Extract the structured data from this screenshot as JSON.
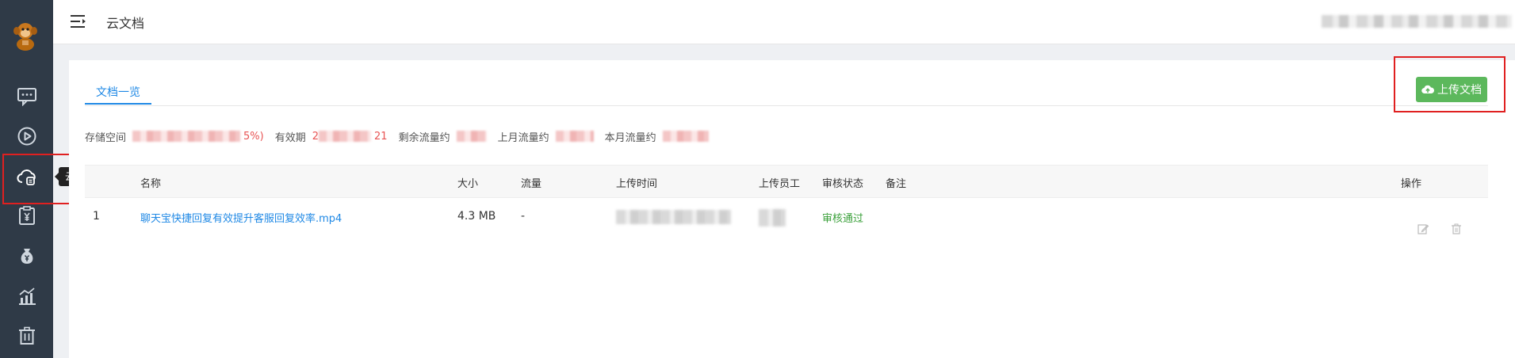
{
  "header": {
    "title": "云文档"
  },
  "sidebar": {
    "items": [
      {
        "icon": "chat-icon"
      },
      {
        "icon": "play-icon"
      },
      {
        "icon": "cloud-document-icon",
        "active": true
      },
      {
        "icon": "clipboard-yuan-icon"
      },
      {
        "icon": "money-bag-icon"
      },
      {
        "icon": "chart-icon"
      },
      {
        "icon": "trash-icon"
      }
    ],
    "tooltip": "云文档管理"
  },
  "tabs": [
    {
      "label": "文档一览"
    }
  ],
  "toolbar": {
    "upload_label": "上传文档"
  },
  "stats": {
    "storage_label": "存储空间",
    "storage_value_suffix": "5%)",
    "validity_label": "有效期",
    "validity_value_prefix": "2",
    "validity_value_suffix": "21",
    "remaining_label": "剩余流量约",
    "last_month_label": "上月流量约",
    "this_month_label": "本月流量约"
  },
  "table": {
    "columns": [
      "名称",
      "大小",
      "流量",
      "上传时间",
      "上传员工",
      "审核状态",
      "备注",
      "操作"
    ],
    "rows": [
      {
        "index": "1",
        "name": "聊天宝快捷回复有效提升客服回复效率.mp4",
        "size": "4.3 MB",
        "traffic": "-",
        "status": "审核通过",
        "remark": ""
      }
    ]
  },
  "colors": {
    "sidebar_bg": "#2f3a47",
    "link": "#1e88e5",
    "success": "#5cb85c",
    "highlight": "#e02020"
  }
}
